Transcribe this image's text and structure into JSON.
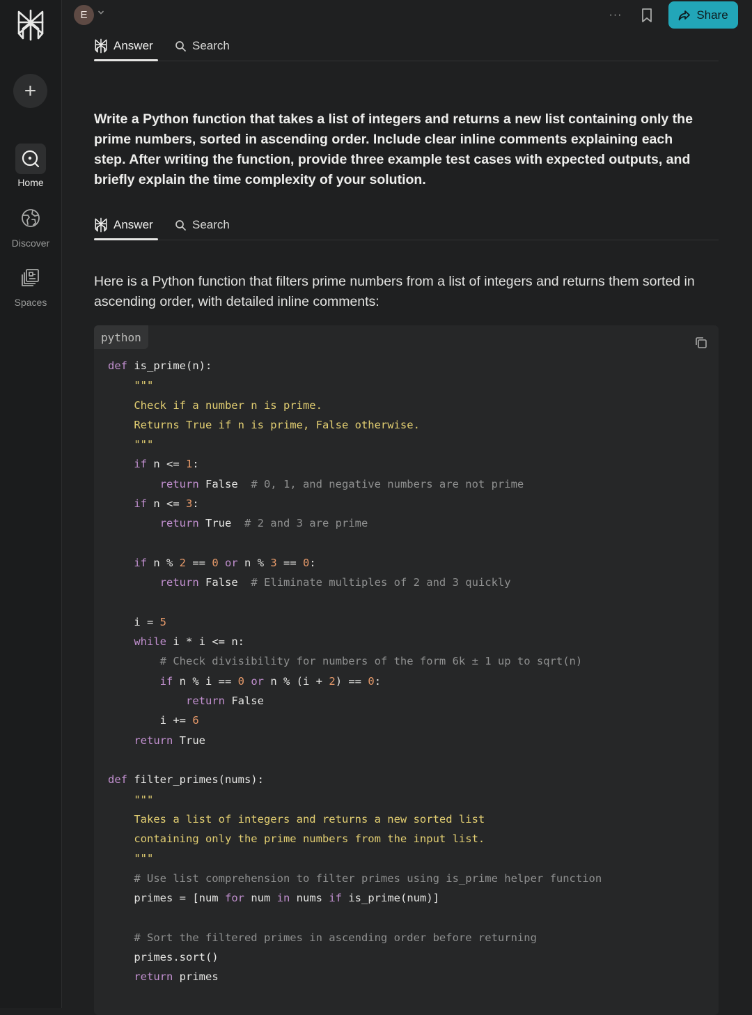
{
  "sidebar": {
    "new_label": "+",
    "items": [
      {
        "label": "Home",
        "icon": "home-icon"
      },
      {
        "label": "Discover",
        "icon": "globe-icon"
      },
      {
        "label": "Spaces",
        "icon": "spaces-icon"
      }
    ]
  },
  "header": {
    "avatar_initial": "E",
    "more_label": "···",
    "share_label": "Share"
  },
  "tabs": [
    {
      "label": "Answer",
      "icon": "perplexity-icon"
    },
    {
      "label": "Search",
      "icon": "search-icon"
    }
  ],
  "thread": {
    "query": "Write a Python function that takes a list of integers and returns a new list containing only the prime numbers, sorted in ascending order. Include clear inline comments explaining each step. After writing the function, provide three example test cases with expected outputs, and briefly explain the time complexity of your solution.",
    "answer_intro": "Here is a Python function that filters prime numbers from a list of integers and returns them sorted in ascending order, with detailed inline comments:",
    "code_language": "python",
    "code_lines": [
      "def is_prime(n):",
      "    \"\"\"",
      "    Check if a number n is prime.",
      "    Returns True if n is prime, False otherwise.",
      "    \"\"\"",
      "    if n <= 1:",
      "        return False  # 0, 1, and negative numbers are not prime",
      "    if n <= 3:",
      "        return True  # 2 and 3 are prime",
      "",
      "    if n % 2 == 0 or n % 3 == 0:",
      "        return False  # Eliminate multiples of 2 and 3 quickly",
      "",
      "    i = 5",
      "    while i * i <= n:",
      "        # Check divisibility for numbers of the form 6k ± 1 up to sqrt(n)",
      "        if n % i == 0 or n % (i + 2) == 0:",
      "            return False",
      "        i += 6",
      "    return True",
      "",
      "def filter_primes(nums):",
      "    \"\"\"",
      "    Takes a list of integers and returns a new sorted list",
      "    containing only the prime numbers from the input list.",
      "    \"\"\"",
      "    # Use list comprehension to filter primes using is_prime helper function",
      "    primes = [num for num in nums if is_prime(num)]",
      "",
      "    # Sort the filtered primes in ascending order before returning",
      "    primes.sort()",
      "    return primes"
    ]
  },
  "colors": {
    "background": "#1f2021",
    "accent": "#22a6b8",
    "keyword": "#c290d0",
    "string": "#e3cf72",
    "number": "#e79a6a",
    "comment": "#8f9090"
  }
}
